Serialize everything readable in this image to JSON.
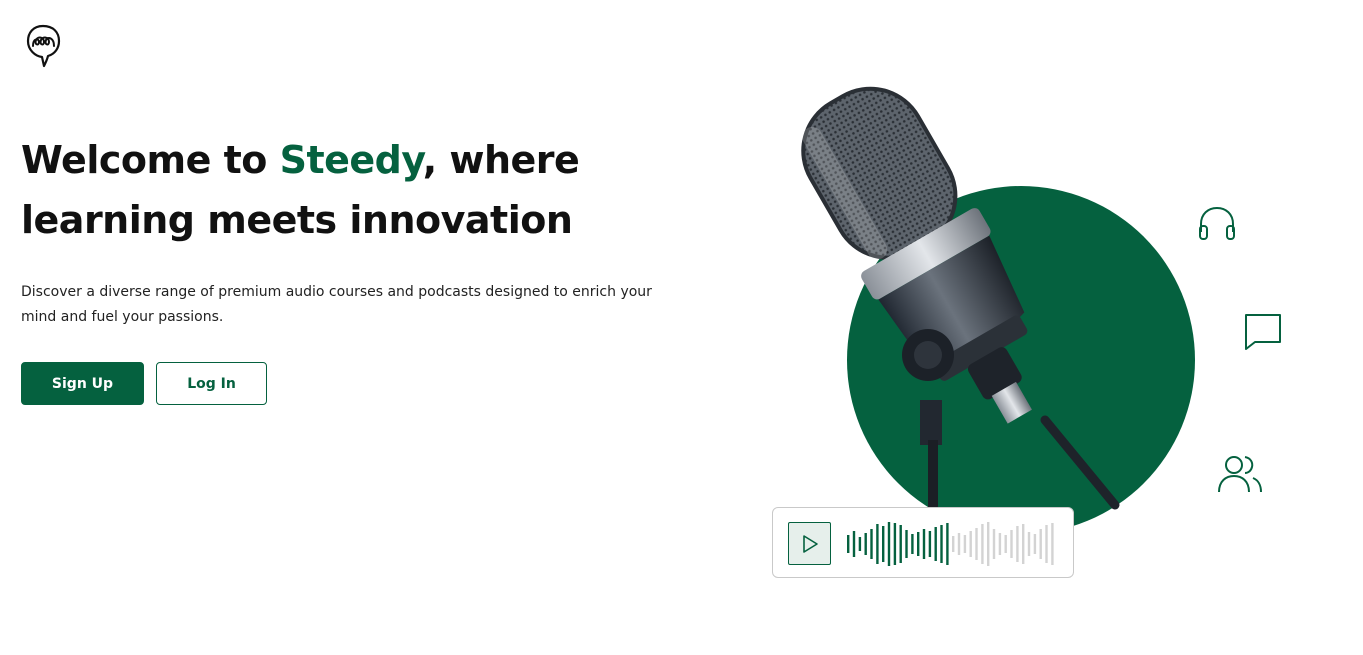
{
  "brand": {
    "logo_icon": "speech-bubble-loop-icon"
  },
  "hero": {
    "headline_part1": "Welcome to ",
    "headline_brand": "Steedy",
    "headline_part2": ", where learning meets innovation",
    "description": "Discover a diverse range of premium audio courses and podcasts designed to enrich your mind and fuel your passions."
  },
  "actions": {
    "signup_label": "Sign Up",
    "login_label": "Log In"
  },
  "illustration": {
    "image": "studio-microphone",
    "side_icons": [
      "headphones-icon",
      "chat-bubble-icon",
      "users-icon"
    ],
    "player": {
      "play_icon": "play-icon",
      "waveform_played_fraction": 0.48
    }
  },
  "colors": {
    "accent": "#05613f",
    "text": "#111111",
    "waveform_unplayed": "#d3d3d3"
  }
}
